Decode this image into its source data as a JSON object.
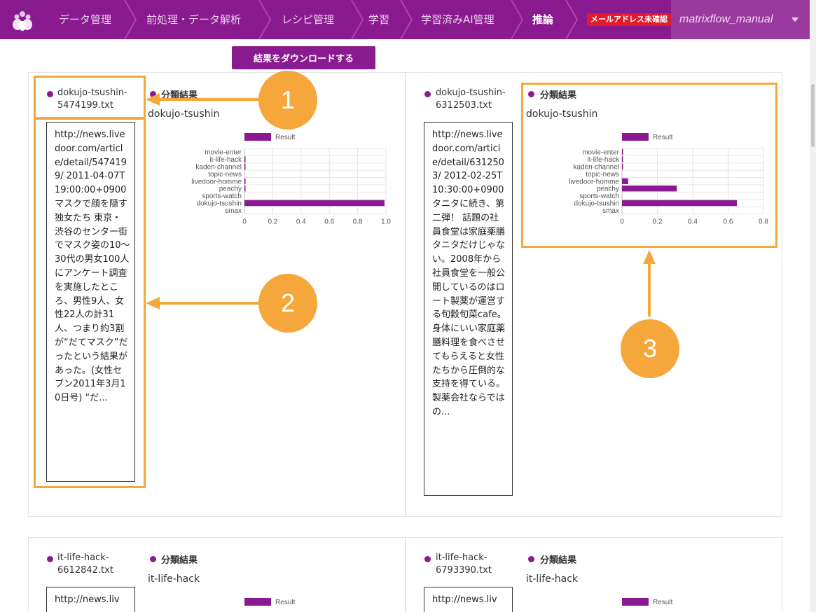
{
  "colors": {
    "brand": "#8a1a8f",
    "accent": "#f6a73b",
    "badge": "#e21b2c",
    "bar": "#8a1a8f"
  },
  "nav": {
    "logo_icon": "flower-logo-icon",
    "items": [
      {
        "label": "データ管理"
      },
      {
        "label": "前処理・データ解析"
      },
      {
        "label": "レシピ管理"
      },
      {
        "label": "学習"
      },
      {
        "label": "学習済みAI管理"
      },
      {
        "label": "推論",
        "active": true
      }
    ],
    "email_badge": "メールアドレス未確認",
    "user_name": "matrixflow_manual"
  },
  "toolbar": {
    "download_label": "結果をダウンロードする"
  },
  "results": [
    {
      "filename": "dokujo-tsushin-\n5474199.txt",
      "section_title": "分類結果",
      "predicted_label": "dokujo-tsushin",
      "text": "http://news.livedoor.com/article/detail/5474199/ 2011-04-07T19:00:00+0900 マスクで顔を隠す独女たち 東京・渋谷のセンター街でマスク姿の10〜30代の男女100人にアンケート調査を実施したところ、男性9人、女性22人の計31人、つまり約3割が“だてマスク”だったという結果があった。(女性セブン2011年3月10日号) “だ..."
    },
    {
      "filename": "dokujo-tsushin-\n6312503.txt",
      "section_title": "分類結果",
      "predicted_label": "dokujo-tsushin",
      "text": "http://news.livedoor.com/article/detail/6312503/ 2012-02-25T10:30:00+0900 タニタに続き、第二弾！ 話題の社員食堂は家庭薬膳 タニタだけじゃない。2008年から社員食堂を一般公開しているのはロート製薬が運営する旬穀旬菜cafe。身体にいい家庭薬膳料理を食べさせてもらえると女性たちから圧倒的な支持を得ている。 製薬会社ならではの..."
    },
    {
      "filename": "it-life-hack-\n6612842.txt",
      "section_title": "分類結果",
      "predicted_label": "it-life-hack",
      "text": "http://news.liv"
    },
    {
      "filename": "it-life-hack-\n6793390.txt",
      "section_title": "分類結果",
      "predicted_label": "it-life-hack",
      "text": "http://news.liv"
    }
  ],
  "chart_data": [
    {
      "type": "bar",
      "orientation": "horizontal",
      "legend": "Result",
      "categories": [
        "movie-enter",
        "it-life-hack",
        "kaden-channel",
        "topic-news",
        "livedoor-homme",
        "peachy",
        "sports-watch",
        "dokujo-tsushin",
        "smax"
      ],
      "series": [
        {
          "name": "Result",
          "values": [
            0.0,
            0.003,
            0.002,
            0.0,
            0.002,
            0.003,
            0.0,
            0.99,
            0.0
          ]
        }
      ],
      "xlim": [
        0,
        1.0
      ],
      "xticks": [
        "0",
        "0.2",
        "0.4",
        "0.6",
        "0.8",
        "1.0"
      ],
      "grid": true
    },
    {
      "type": "bar",
      "orientation": "horizontal",
      "legend": "Result",
      "categories": [
        "movie-enter",
        "it-life-hack",
        "kaden-channel",
        "topic-news",
        "livedoor-homme",
        "peachy",
        "sports-watch",
        "dokujo-tsushin",
        "smax"
      ],
      "series": [
        {
          "name": "Result",
          "values": [
            0.005,
            0.003,
            0.003,
            0.0,
            0.035,
            0.31,
            0.0,
            0.65,
            0.0
          ]
        }
      ],
      "xlim": [
        0,
        0.8
      ],
      "xticks": [
        "0",
        "0.2",
        "0.4",
        "0.6",
        "0.8"
      ],
      "grid": true
    },
    {
      "type": "bar",
      "orientation": "horizontal",
      "legend": "Result"
    },
    {
      "type": "bar",
      "orientation": "horizontal",
      "legend": "Result"
    }
  ],
  "annotations": [
    {
      "number": "1"
    },
    {
      "number": "2"
    },
    {
      "number": "3"
    }
  ]
}
